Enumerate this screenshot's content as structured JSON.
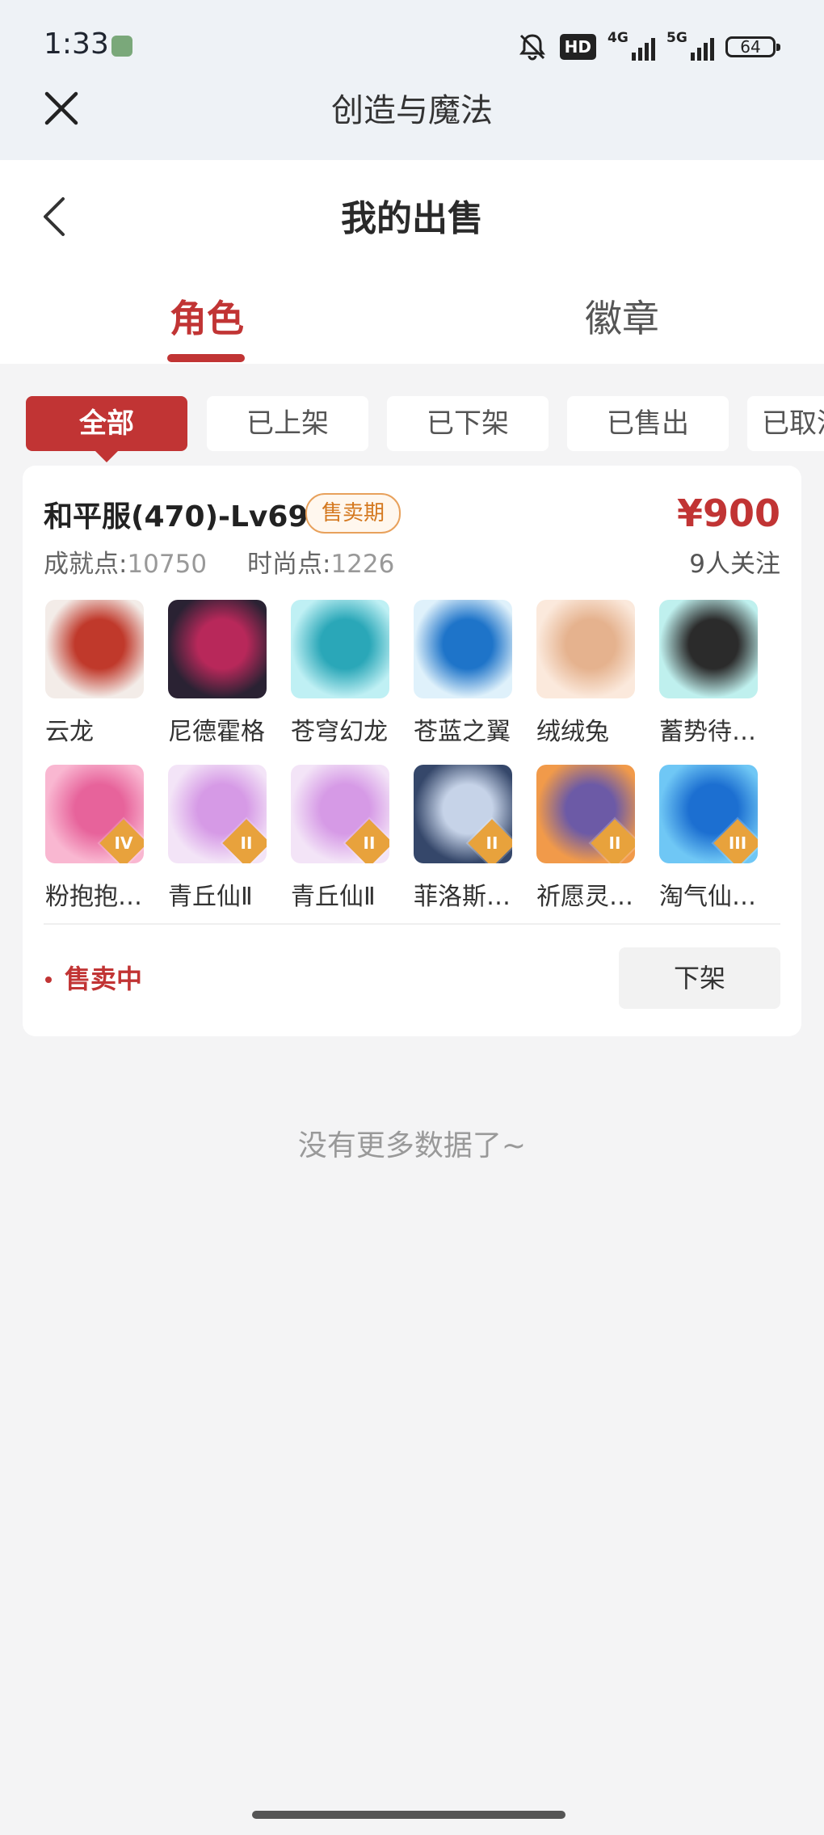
{
  "status_bar": {
    "time": "1:33",
    "hd_label": "HD",
    "net1": "4G",
    "net2": "5G",
    "battery": "64"
  },
  "webview": {
    "title": "创造与魔法"
  },
  "header": {
    "title": "我的出售"
  },
  "tabs": [
    {
      "label": "角色",
      "active": true
    },
    {
      "label": "徽章",
      "active": false
    }
  ],
  "filters": [
    {
      "label": "全部",
      "active": true
    },
    {
      "label": "已上架",
      "active": false
    },
    {
      "label": "已下架",
      "active": false
    },
    {
      "label": "已售出",
      "active": false
    },
    {
      "label": "已取消",
      "active": false
    }
  ],
  "listing": {
    "name": "和平服(470)-Lv69",
    "tag": "售卖期",
    "price": "¥900",
    "achievement_label": "成就点:",
    "achievement_value": "10750",
    "fashion_label": "时尚点:",
    "fashion_value": "1226",
    "followers": "9人关注",
    "pets": [
      {
        "name": "云龙",
        "colors": [
          "#f3ece8",
          "#c0392b"
        ],
        "rank": ""
      },
      {
        "name": "尼德霍格",
        "colors": [
          "#2a2233",
          "#b8285a"
        ],
        "rank": ""
      },
      {
        "name": "苍穹幻龙",
        "colors": [
          "#bff0f4",
          "#2aa7b8"
        ],
        "rank": ""
      },
      {
        "name": "苍蓝之翼",
        "colors": [
          "#dff1fb",
          "#1e74c9"
        ],
        "rank": ""
      },
      {
        "name": "绒绒兔",
        "colors": [
          "#fbe9dc",
          "#e5b28e"
        ],
        "rank": ""
      },
      {
        "name": "蓄势待…",
        "colors": [
          "#bff0ee",
          "#2b2b2b"
        ],
        "rank": ""
      },
      {
        "name": "粉抱抱…",
        "colors": [
          "#f9b7d1",
          "#e7639b"
        ],
        "rank": "IV"
      },
      {
        "name": "青丘仙Ⅱ",
        "colors": [
          "#f3e4f7",
          "#d69ae6"
        ],
        "rank": "II"
      },
      {
        "name": "青丘仙Ⅱ",
        "colors": [
          "#f3e4f7",
          "#d69ae6"
        ],
        "rank": "II"
      },
      {
        "name": "菲洛斯…",
        "colors": [
          "#35476a",
          "#c6d3e8"
        ],
        "rank": "II"
      },
      {
        "name": "祈愿灵…",
        "colors": [
          "#f19a4a",
          "#6c5aa6"
        ],
        "rank": "II"
      },
      {
        "name": "淘气仙…",
        "colors": [
          "#6fc7f5",
          "#1c6fd1"
        ],
        "rank": "III"
      }
    ],
    "status": "售卖中",
    "action": "下架"
  },
  "footer": {
    "no_more": "没有更多数据了~"
  }
}
